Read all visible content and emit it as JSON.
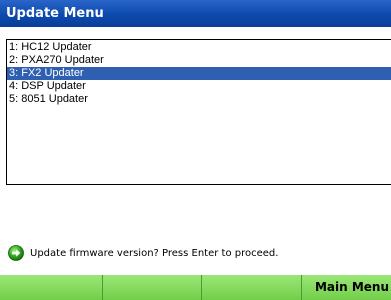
{
  "header": {
    "title": "Update Menu"
  },
  "menu": {
    "items": [
      {
        "label": "1: HC12 Updater",
        "selected": false
      },
      {
        "label": "2: PXA270 Updater",
        "selected": false
      },
      {
        "label": "3: FX2 Updater",
        "selected": true
      },
      {
        "label": "4: DSP Updater",
        "selected": false
      },
      {
        "label": "5: 8051 Updater",
        "selected": false
      }
    ]
  },
  "status": {
    "icon": "green-arrow-right-icon",
    "message": "Update firmware version? Press Enter to proceed."
  },
  "softkeys": [
    {
      "label": ""
    },
    {
      "label": ""
    },
    {
      "label": ""
    },
    {
      "label": "Main Menu"
    }
  ],
  "colors": {
    "title_bar": "#0c49ad",
    "selection": "#2f5fb0",
    "softkey": "#7dd657"
  }
}
